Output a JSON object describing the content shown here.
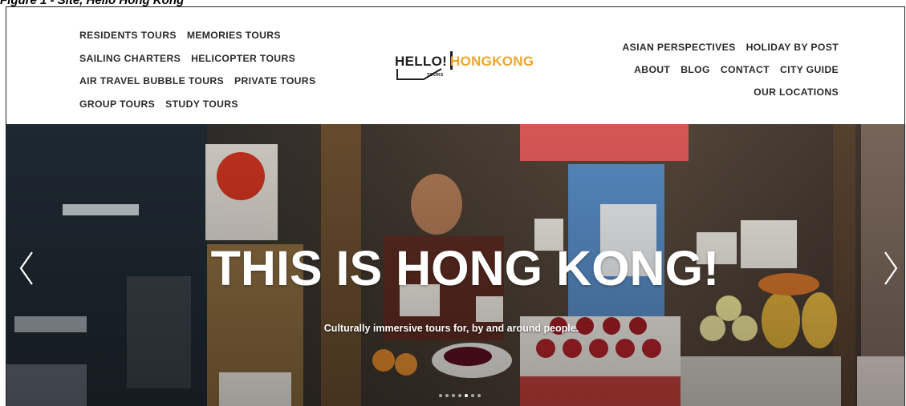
{
  "caption": "Figure 1 - Site, Hello Hong Kong",
  "brand": {
    "hello": "HELLO!",
    "hongkong": "HONGKONG",
    "tours": "TOURS",
    "accent_color": "#f0a52c"
  },
  "nav_left": [
    [
      "RESIDENTS TOURS",
      "MEMORIES TOURS"
    ],
    [
      "SAILING CHARTERS",
      "HELICOPTER TOURS"
    ],
    [
      "AIR TRAVEL BUBBLE TOURS",
      "PRIVATE TOURS"
    ],
    [
      "GROUP TOURS",
      "STUDY TOURS"
    ]
  ],
  "nav_right": [
    [
      "ASIAN PERSPECTIVES",
      "HOLIDAY BY POST"
    ],
    [
      "ABOUT",
      "BLOG",
      "CONTACT",
      "CITY GUIDE"
    ],
    [
      "OUR LOCATIONS"
    ]
  ],
  "hero": {
    "title": "THIS IS HONG KONG!",
    "subtitle": "Culturally immersive tours for, by and around people.",
    "slide_count": 7,
    "active_slide": 4
  },
  "icons": {
    "prev": "chevron-left-icon",
    "next": "chevron-right-icon"
  }
}
